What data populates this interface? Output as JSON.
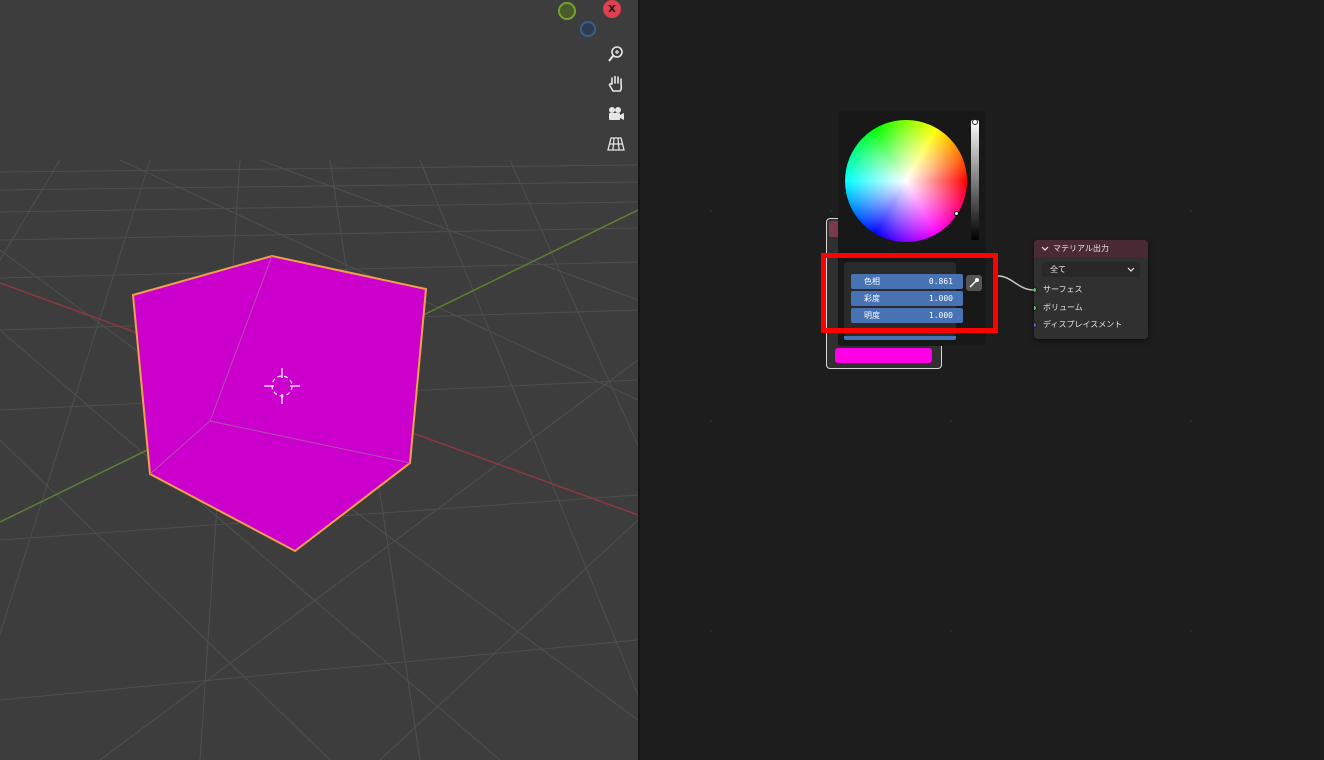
{
  "viewport": {
    "gizmo_x_label": "X",
    "axis_colors": {
      "x": "#e0414f",
      "y": "#75a230",
      "z": "#3a5d8f"
    },
    "nav_icons": [
      "zoom-icon",
      "hand-pan-icon",
      "camera-icon",
      "grid-perspective-icon"
    ],
    "object_color": "#cc00cc",
    "selection_outline": "#f0a04a"
  },
  "color_picker": {
    "hue_label": "色相",
    "hue_value": "0.861",
    "saturation_label": "彩度",
    "saturation_value": "1.000",
    "value_label": "明度",
    "value_value": "1.000",
    "eyedropper_icon": "eyedropper-icon",
    "field_color": "#4772b3",
    "highlight_color": "#ff0000"
  },
  "rgb_node": {
    "swatch_color": "#ff00e6"
  },
  "material_output": {
    "title": "マテリアル出力",
    "target": "全て",
    "sockets": [
      {
        "label": "サーフェス",
        "color": "#63c763"
      },
      {
        "label": "ボリューム",
        "color": "#63c763"
      },
      {
        "label": "ディスプレイスメント",
        "color": "#6363c7"
      }
    ]
  }
}
